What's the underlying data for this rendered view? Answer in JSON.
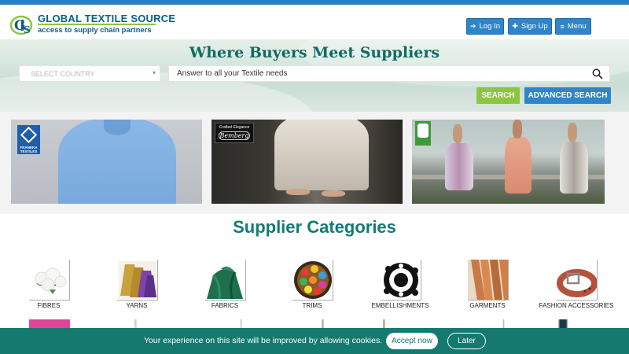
{
  "header": {
    "logo_line1": "GLOBAL TEXTILE SOURCE",
    "logo_line2": "access to supply chain partners",
    "login_label": "Log In",
    "signup_label": "Sign Up",
    "menu_label": "Menu"
  },
  "hero": {
    "title": "Where Buyers Meet Suppliers",
    "country_placeholder": "SELECT COUNTRY",
    "search_placeholder": "Answer to all your Textile needs",
    "search_button": "SEARCH",
    "advanced_search_button": "ADVANCED SEARCH"
  },
  "banners": {
    "franeka_text": "FRANEKA TEXTILES",
    "bemberg_tagline": "Crafted Elegance",
    "bemberg_brand": "Bemberg"
  },
  "categories": {
    "title": "Supplier Categories",
    "items": [
      {
        "label": "FIBRES"
      },
      {
        "label": "YARNS"
      },
      {
        "label": "FABRICS"
      },
      {
        "label": "TRIMS"
      },
      {
        "label": "EMBELLISHMENTS"
      },
      {
        "label": "GARMENTS"
      },
      {
        "label": "FASHION ACCESSORIES"
      }
    ]
  },
  "cookie": {
    "message": "Your experience on this site will be improved by allowing cookies.",
    "accept_label": "Accept now",
    "later_label": "Later"
  },
  "colors": {
    "brand_blue": "#2f85c9",
    "brand_green": "#8cc63f",
    "brand_teal": "#137a74"
  }
}
